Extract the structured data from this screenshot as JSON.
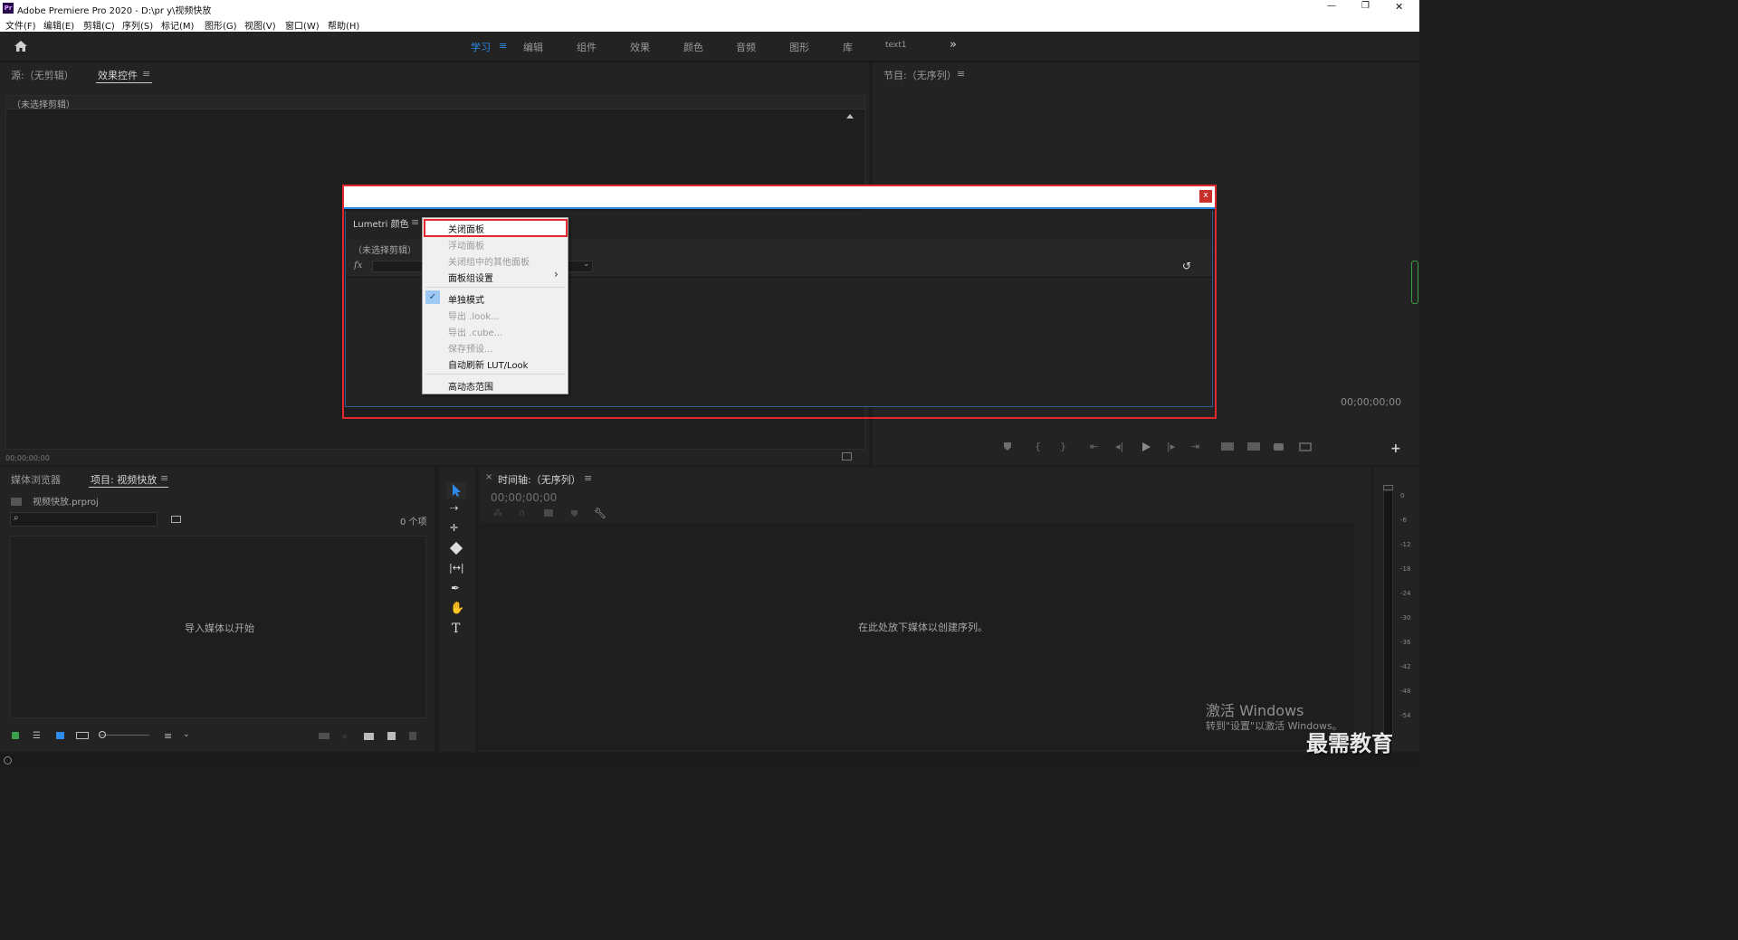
{
  "window": {
    "title": "Adobe Premiere Pro 2020 - D:\\pr y\\视频快放",
    "app_badge": "Pr",
    "controls": {
      "minimize": "—",
      "restore": "❐",
      "close": "✕"
    }
  },
  "menubar": [
    "文件(F)",
    "编辑(E)",
    "剪辑(C)",
    "序列(S)",
    "标记(M)",
    "图形(G)",
    "视图(V)",
    "窗口(W)",
    "帮助(H)"
  ],
  "workspaces": {
    "tabs": [
      "学习",
      "编辑",
      "组件",
      "效果",
      "颜色",
      "音频",
      "图形",
      "库",
      "text1"
    ],
    "active": "学习",
    "more": "»",
    "menu_glyph": "≡"
  },
  "source_panel": {
    "tab_source": "源:（无剪辑）",
    "tab_effects": "效果控件",
    "menu_glyph": "≡",
    "subheader": "（未选择剪辑）",
    "timecode": "00;00;00;00"
  },
  "program_panel": {
    "tab": "节目:（无序列）",
    "menu_glyph": "≡",
    "timecode": "00;00;00;00"
  },
  "floating_window": {
    "close_label": "x",
    "panel_tab": "Lumetri 颜色",
    "menu_glyph": "≡",
    "subheader": "（未选择剪辑）",
    "fx_label": "fx",
    "reset_glyph": "↺"
  },
  "context_menu": {
    "items": [
      {
        "label": "关闭面板",
        "enabled": true,
        "highlighted": true
      },
      {
        "label": "浮动面板",
        "enabled": false
      },
      {
        "label": "关闭组中的其他面板",
        "enabled": false
      },
      {
        "label": "面板组设置",
        "enabled": true,
        "submenu": true
      },
      {
        "label": "单独模式",
        "enabled": true,
        "checked": true
      },
      {
        "label": "导出 .look...",
        "enabled": false
      },
      {
        "label": "导出 .cube...",
        "enabled": false
      },
      {
        "label": "保存预设...",
        "enabled": false
      },
      {
        "label": "自动刷新 LUT/Look",
        "enabled": true
      },
      {
        "label": "高动态范围",
        "enabled": true
      }
    ],
    "submenu_arrow": "›",
    "check_glyph": "✓"
  },
  "project_panel": {
    "tab_media": "媒体浏览器",
    "tab_project": "项目: 视频快放",
    "menu_glyph": "≡",
    "file_name": "视频快放.prproj",
    "item_count": "0 个项",
    "empty_text": "导入媒体以开始"
  },
  "timeline_panel": {
    "close": "×",
    "tab": "时间轴:（无序列）",
    "menu_glyph": "≡",
    "timecode": "00;00;00;00",
    "empty_text": "在此处放下媒体以创建序列。"
  },
  "audio_meter": {
    "labels": [
      "0",
      "-6",
      "-12",
      "-18",
      "-24",
      "-30",
      "-36",
      "-42",
      "-48",
      "-54"
    ]
  },
  "overlays": {
    "activate_title": "激活 Windows",
    "activate_sub": "转到\"设置\"以激活 Windows。",
    "watermark": "最需教育"
  },
  "colors": {
    "accent_blue": "#2d8ceb",
    "highlight_red": "#e0282e",
    "panel_bg": "#232323",
    "menu_bg": "#f0f0f0"
  }
}
